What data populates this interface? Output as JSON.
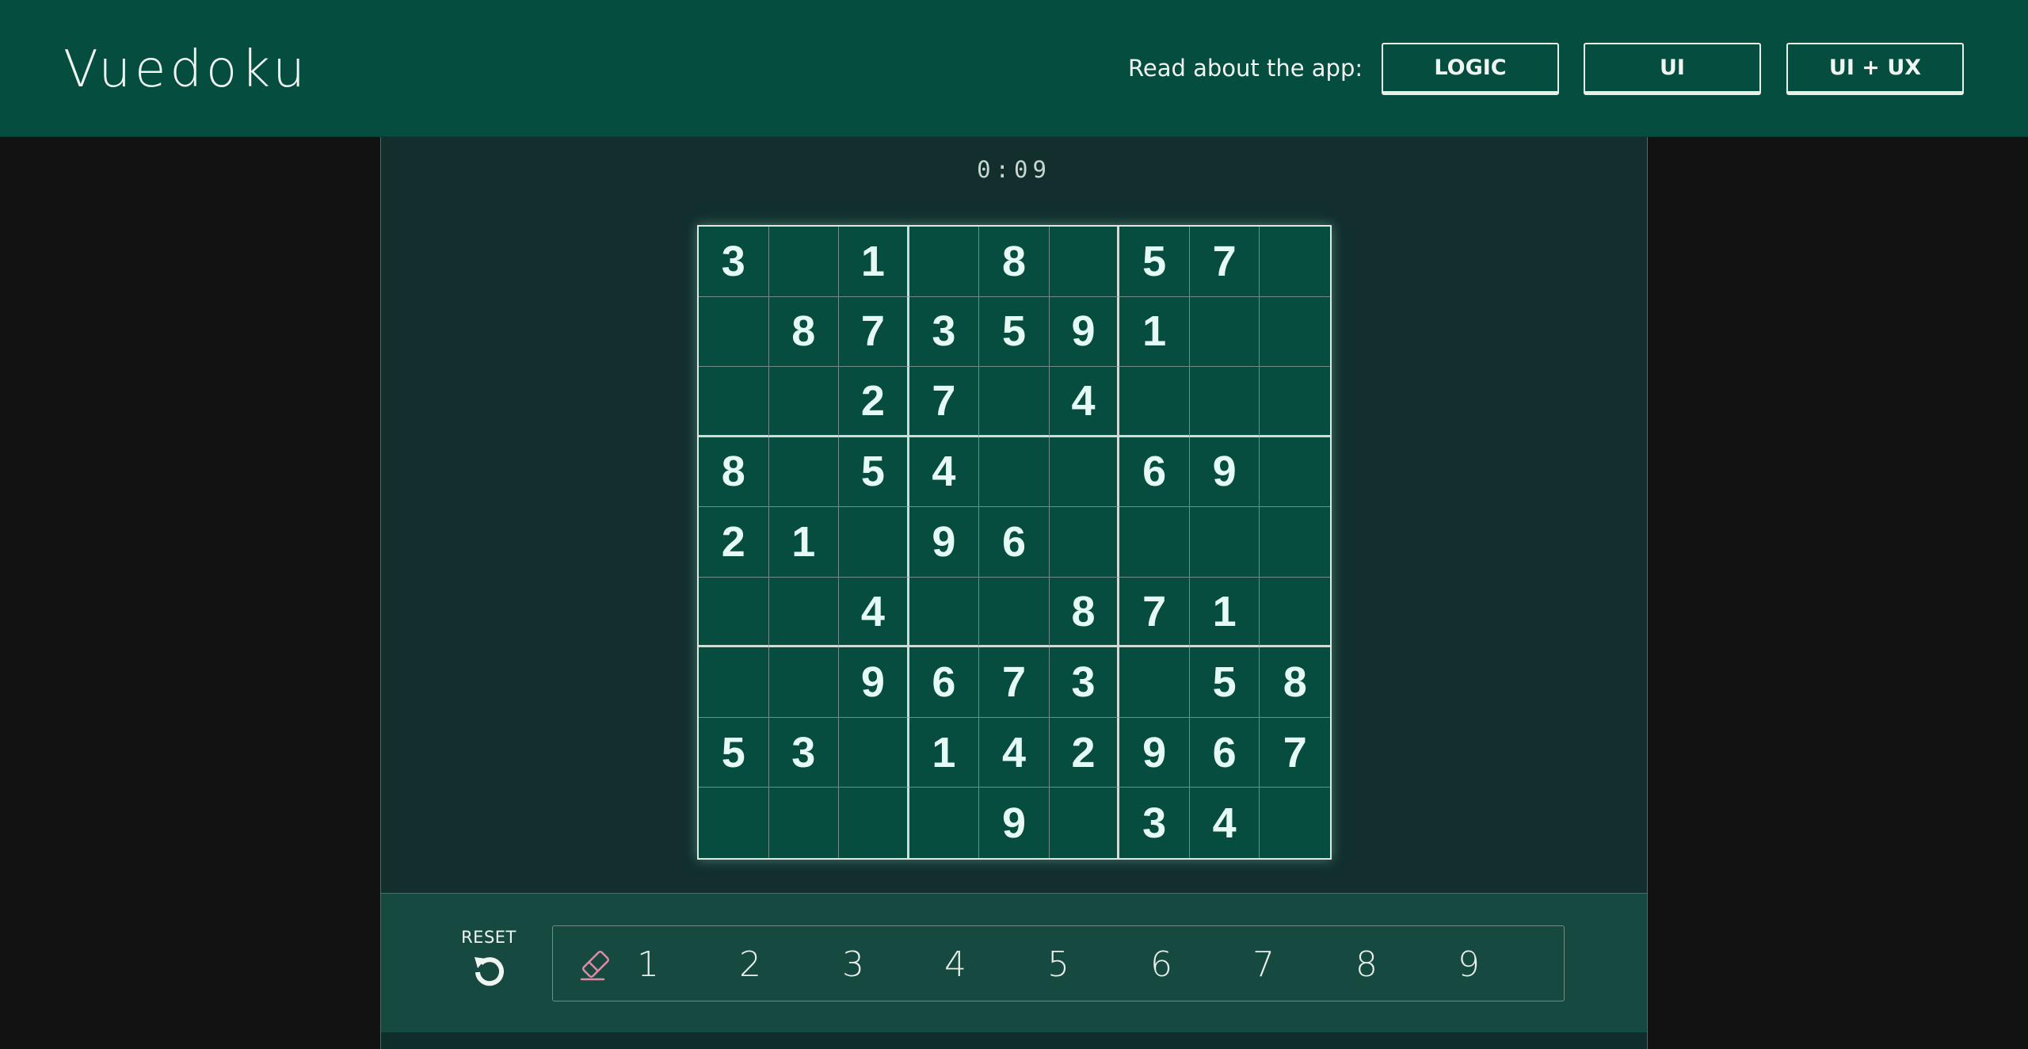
{
  "header": {
    "logo": "Vuedoku",
    "read_label": "Read about the app:",
    "buttons": [
      "LOGIC",
      "UI",
      "UI + UX"
    ]
  },
  "timer": "0:09",
  "board": [
    [
      "3",
      "",
      "1",
      "",
      "8",
      "",
      "5",
      "7",
      ""
    ],
    [
      "",
      "8",
      "7",
      "3",
      "5",
      "9",
      "1",
      "",
      ""
    ],
    [
      "",
      "",
      "2",
      "7",
      "",
      "4",
      "",
      "",
      ""
    ],
    [
      "8",
      "",
      "5",
      "4",
      "",
      "",
      "6",
      "9",
      ""
    ],
    [
      "2",
      "1",
      "",
      "9",
      "6",
      "",
      "",
      "",
      ""
    ],
    [
      "",
      "",
      "4",
      "",
      "",
      "8",
      "7",
      "1",
      ""
    ],
    [
      "",
      "",
      "9",
      "6",
      "7",
      "3",
      "",
      "5",
      "8"
    ],
    [
      "5",
      "3",
      "",
      "1",
      "4",
      "2",
      "9",
      "6",
      "7"
    ],
    [
      "",
      "",
      "",
      "",
      "9",
      "",
      "3",
      "4",
      ""
    ]
  ],
  "controls": {
    "reset_label": "RESET",
    "reset_icon": "reset-icon",
    "eraser_icon": "eraser-icon",
    "numbers": [
      "1",
      "2",
      "3",
      "4",
      "5",
      "6",
      "7",
      "8",
      "9"
    ]
  },
  "colors": {
    "header_bg": "#054d3f",
    "cell_bg": "#064d3f",
    "panel_bg": "#122f2e",
    "eraser": "#e08aa8"
  }
}
